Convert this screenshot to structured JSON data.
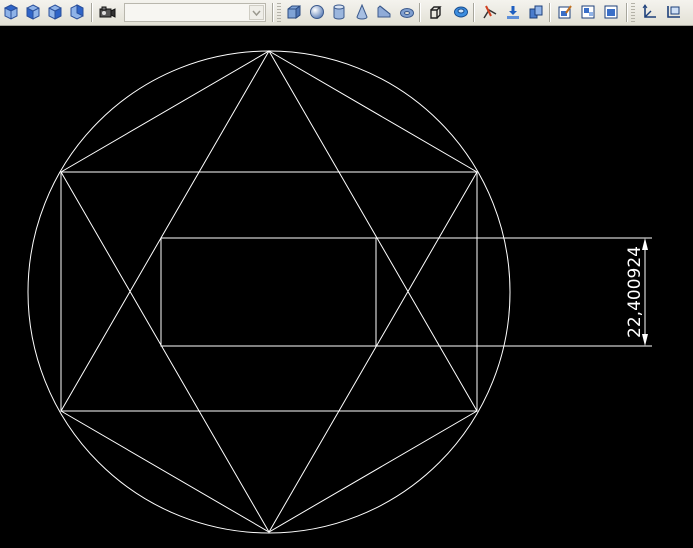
{
  "toolbar": {
    "view_dropdown": {
      "value": ""
    },
    "buttons": [
      {
        "name": "top-view-icon",
        "color": "#3a6fd8"
      },
      {
        "name": "front-view-icon",
        "color": "#3a6fd8"
      },
      {
        "name": "left-view-icon",
        "color": "#3a6fd8"
      },
      {
        "name": "right-view-icon",
        "color": "#3a6fd8"
      },
      {
        "name": "camera-icon",
        "color": "#333333"
      },
      {
        "name": "box-solid-icon",
        "color": "#6a8fbf"
      },
      {
        "name": "sphere-solid-icon",
        "color": "#6a8fbf"
      },
      {
        "name": "cylinder-solid-icon",
        "color": "#6a8fbf"
      },
      {
        "name": "cone-solid-icon",
        "color": "#6a8fbf"
      },
      {
        "name": "wedge-solid-icon",
        "color": "#6a8fbf"
      },
      {
        "name": "torus-solid-icon",
        "color": "#6a8fbf"
      },
      {
        "name": "extrude-icon",
        "color": "#333333"
      },
      {
        "name": "revolve-icon",
        "color": "#2a7fd0"
      },
      {
        "name": "slice-icon",
        "color": "#d04020"
      },
      {
        "name": "section-icon",
        "color": "#2a6fd0"
      },
      {
        "name": "interference-icon",
        "color": "#2a6fd0"
      },
      {
        "name": "setup-drawing-icon",
        "color": "#2a6fd0"
      },
      {
        "name": "setup-view-icon",
        "color": "#2a6fd0"
      },
      {
        "name": "setup-profile-icon",
        "color": "#2a6fd0"
      },
      {
        "name": "ucs-icon",
        "color": "#2a6fd0"
      },
      {
        "name": "ucs-world-icon",
        "color": "#2a6fd0"
      }
    ]
  },
  "drawing": {
    "line_color": "#ffffff",
    "background": "#000000",
    "dimension": {
      "text": "22,400924"
    }
  }
}
